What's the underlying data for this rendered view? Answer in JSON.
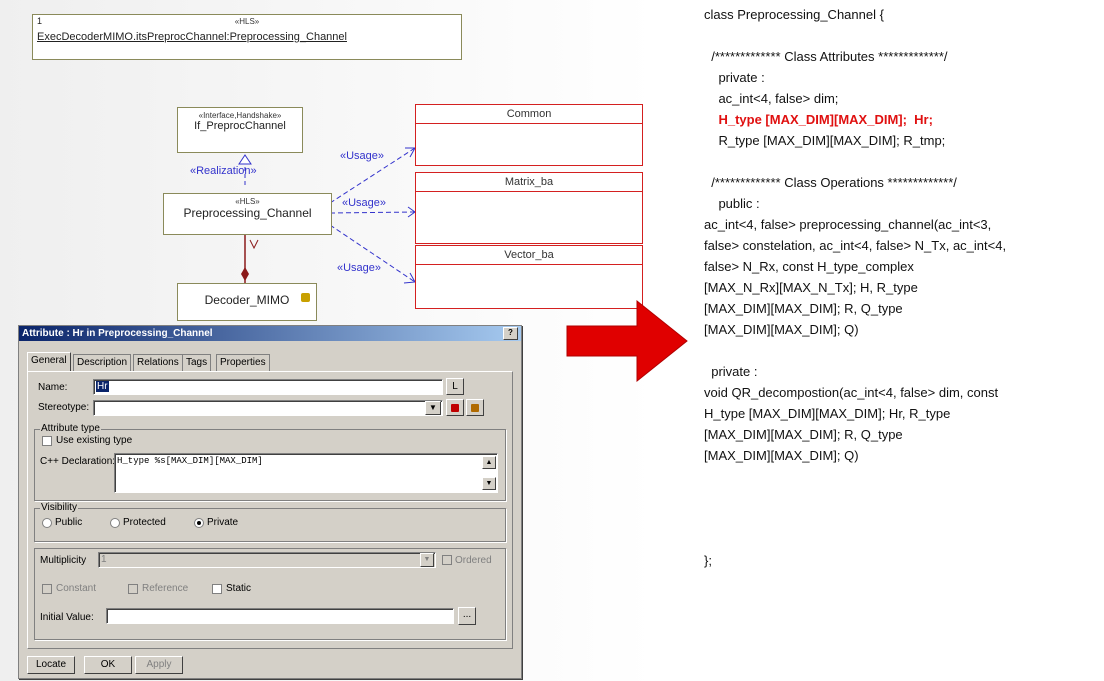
{
  "diagram": {
    "top_box": {
      "number": "1",
      "stereotype": "«HLS»",
      "path": "ExecDecoderMIMO.itsPreprocChannel:Preprocessing_Channel"
    },
    "interface_box": {
      "stereotype": "«Interface,Handshake»",
      "name": "If_PreprocChannel"
    },
    "realization_label": "«Realization»",
    "hls_box": {
      "stereotype": "«HLS»",
      "name": "Preprocessing_Channel"
    },
    "decoder_box": {
      "name": "Decoder_MIMO"
    },
    "red_classes": [
      "Common",
      "Matrix_ba",
      "Vector_ba"
    ],
    "usage_labels": [
      "«Usage»",
      "«Usage»",
      "«Usage»"
    ]
  },
  "dialog": {
    "title": "Attribute : Hr in Preprocessing_Channel",
    "close_glyph": "?",
    "tabs": [
      "General",
      "Description",
      "Relations",
      "Tags",
      "Properties"
    ],
    "name_label": "Name:",
    "name_value": "Hr",
    "name_btn": "L",
    "stereotype_label": "Stereotype:",
    "attr_type_label": "Attribute type",
    "use_existing_label": "Use existing type",
    "cpp_decl_label": "C++ Declaration:",
    "cpp_decl_value": "H_type %s[MAX_DIM][MAX_DIM]",
    "visibility_label": "Visibility",
    "visibility_options": [
      "Public",
      "Protected",
      "Private"
    ],
    "multiplicity_label": "Multiplicity",
    "multiplicity_value": "1",
    "ordered_label": "Ordered",
    "constant_label": "Constant",
    "reference_label": "Reference",
    "static_label": "Static",
    "initial_value_label": "Initial Value:",
    "ellipsis": "...",
    "buttons": [
      "Locate",
      "OK",
      "Apply"
    ]
  },
  "code_panel": {
    "lines": [
      "class Preprocessing_Channel {",
      "",
      "  /************* Class Attributes *************/",
      "    private :",
      "    ac_int<4, false> dim;",
      "    H_type [MAX_DIM][MAX_DIM];  Hr;",
      "    R_type [MAX_DIM][MAX_DIM]; R_tmp;",
      "",
      "  /************* Class Operations *************/",
      "    public :",
      "ac_int<4, false> preprocessing_channel(ac_int<3,",
      "false> constelation, ac_int<4, false> N_Tx, ac_int<4,",
      "false> N_Rx, const H_type_complex",
      "[MAX_N_Rx][MAX_N_Tx]; H, R_type",
      "[MAX_DIM][MAX_DIM]; R, Q_type",
      "[MAX_DIM][MAX_DIM]; Q)",
      "",
      "  private :",
      "void QR_decompostion(ac_int<4, false> dim, const",
      "H_type [MAX_DIM][MAX_DIM]; Hr, R_type",
      "[MAX_DIM][MAX_DIM]; R, Q_type",
      "[MAX_DIM][MAX_DIM]; Q)",
      "",
      "",
      "",
      "",
      "};"
    ],
    "highlight_line": 5
  },
  "colors": {
    "arrow": "#e00000",
    "usage": "#3333cc",
    "red_box": "#d42020"
  }
}
